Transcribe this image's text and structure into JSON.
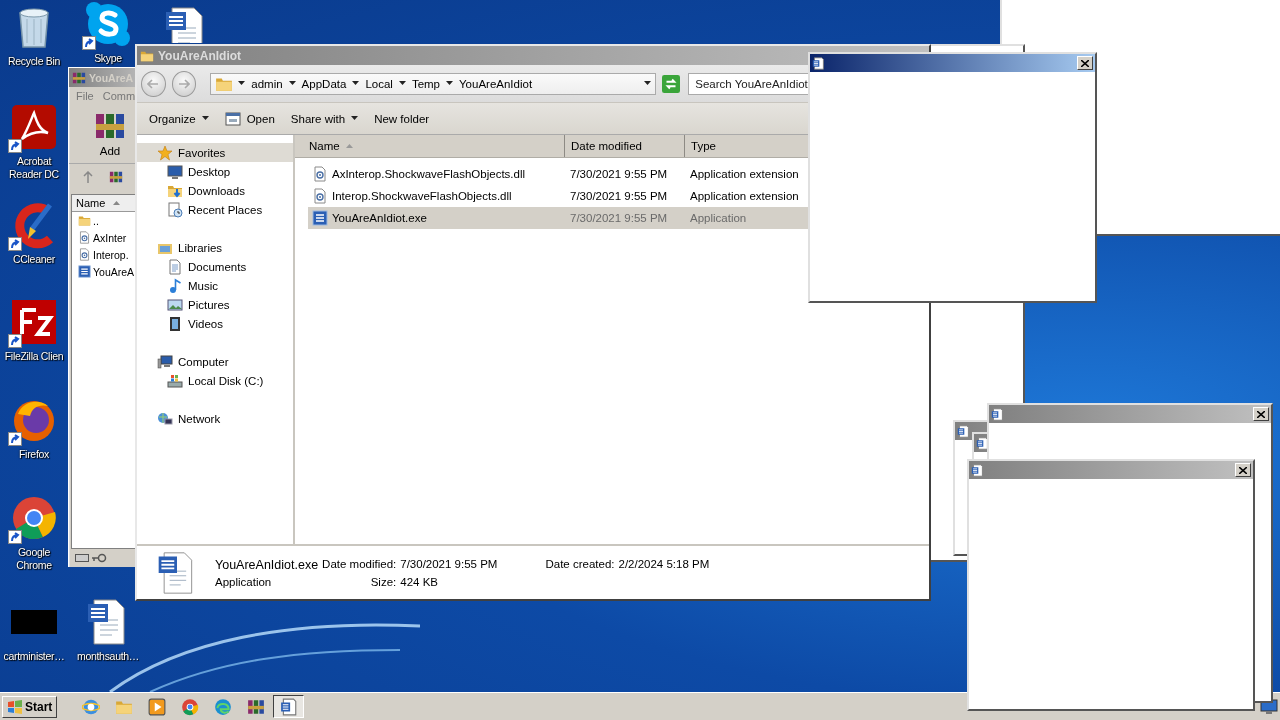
{
  "desktop_icons": [
    {
      "label": "Recycle Bin",
      "kind": "recycle-bin",
      "shortcut": false
    },
    {
      "label": "Skype",
      "kind": "chat",
      "shortcut": true
    },
    {
      "kind": "word-doc",
      "shortcut": false
    },
    {
      "label": "Acrobat Reader DC",
      "kind": "swirl",
      "shortcut": true
    },
    {
      "label": "CCleaner",
      "kind": "brush",
      "shortcut": true
    },
    {
      "label": "FileZilla Clien",
      "kind": "zigzag",
      "shortcut": true
    },
    {
      "label": "Firefox",
      "kind": "fox",
      "shortcut": true
    },
    {
      "label": "Google Chrome",
      "kind": "chrome",
      "shortcut": true
    },
    {
      "label": "cartminister…",
      "kind": "black-file",
      "shortcut": false
    },
    {
      "label": "monthsauth…",
      "kind": "word-doc",
      "shortcut": false
    }
  ],
  "winrar_window": {
    "title": "YouAreA",
    "menu": [
      "File",
      "Comm"
    ],
    "toolbar": [
      "Add"
    ],
    "column": "Name",
    "rows": [
      {
        "name": "..",
        "kind": "folder"
      },
      {
        "name": "AxInter",
        "kind": "dll"
      },
      {
        "name": "Interop.",
        "kind": "dll"
      },
      {
        "name": "YouAreA",
        "kind": "exe"
      }
    ]
  },
  "explorer": {
    "title": "YouAreAnIdiot",
    "breadcrumb": [
      "admin",
      "AppData",
      "Local",
      "Temp",
      "YouAreAnIdiot"
    ],
    "search": {
      "placeholder": "Search YouAreAnIdiot"
    },
    "toolbar": [
      {
        "label": "Organize",
        "kind": "menu"
      },
      {
        "label": "Open",
        "kind": "open"
      },
      {
        "label": "Share with",
        "kind": "menu"
      },
      {
        "label": "New folder",
        "kind": "plain"
      }
    ],
    "nav": [
      {
        "label": "Favorites",
        "kind": "star",
        "selected": true,
        "children": [
          {
            "label": "Desktop",
            "kind": "desktop",
            "selected": false
          },
          {
            "label": "Downloads",
            "kind": "downloads",
            "selected": false
          },
          {
            "label": "Recent Places",
            "kind": "recent",
            "selected": false
          }
        ]
      },
      {
        "label": "Libraries",
        "kind": "library",
        "selected": false,
        "children": [
          {
            "label": "Documents",
            "kind": "documents",
            "selected": false
          },
          {
            "label": "Music",
            "kind": "music",
            "selected": false
          },
          {
            "label": "Pictures",
            "kind": "pictures",
            "selected": false
          },
          {
            "label": "Videos",
            "kind": "videos",
            "selected": false
          }
        ]
      },
      {
        "label": "Computer",
        "kind": "computer",
        "selected": false,
        "children": [
          {
            "label": "Local Disk (C:)",
            "kind": "disk",
            "selected": false
          }
        ]
      },
      {
        "label": "Network",
        "kind": "network",
        "selected": false
      }
    ],
    "columns": [
      {
        "label": "Name",
        "sorted": true
      },
      {
        "label": "Date modified",
        "sorted": false
      },
      {
        "label": "Type",
        "sorted": false
      }
    ],
    "files": [
      {
        "name": "AxInterop.ShockwaveFlashObjects.dll",
        "date": "7/30/2021 9:55 PM",
        "type": "Application extension",
        "kind": "dll",
        "selected": false
      },
      {
        "name": "Interop.ShockwaveFlashObjects.dll",
        "date": "7/30/2021 9:55 PM",
        "type": "Application extension",
        "kind": "dll",
        "selected": false
      },
      {
        "name": "YouAreAnIdiot.exe",
        "date": "7/30/2021 9:55 PM",
        "type": "Application",
        "kind": "exe",
        "selected": true
      }
    ],
    "details": {
      "name": "YouAreAnIdiot.exe",
      "type": "Application",
      "fields": [
        {
          "label": "Date modified:",
          "value": "7/30/2021 9:55 PM"
        },
        {
          "label": "Date created:",
          "value": "2/2/2024 5:18 PM"
        },
        {
          "label": "Size:",
          "value": "424 KB"
        }
      ]
    }
  },
  "popups": [
    {
      "active": false
    },
    {
      "active": false
    },
    {
      "active": false
    },
    {
      "active": false
    },
    {
      "active": true
    }
  ],
  "taskbar": {
    "start": "Start",
    "apps": [
      {
        "kind": "ie",
        "active": false
      },
      {
        "kind": "folder",
        "active": false
      },
      {
        "kind": "media",
        "active": false
      },
      {
        "kind": "chrome",
        "active": false
      },
      {
        "kind": "edge",
        "active": false
      },
      {
        "kind": "winrar",
        "active": false
      },
      {
        "kind": "word",
        "active": true
      }
    ]
  }
}
